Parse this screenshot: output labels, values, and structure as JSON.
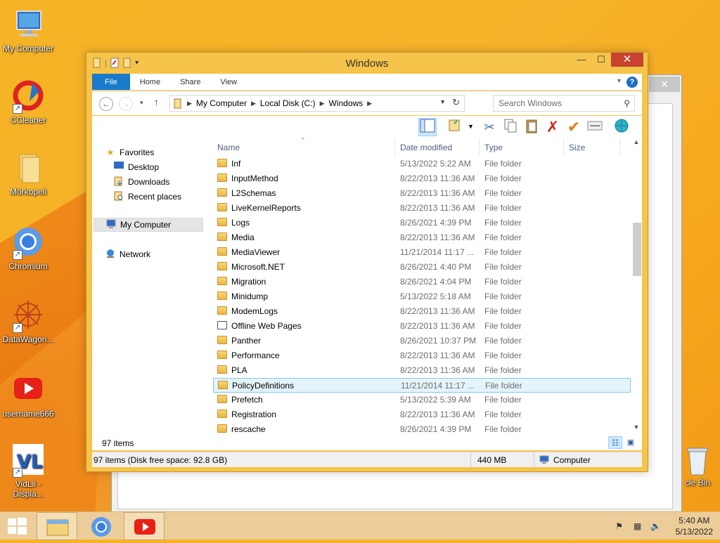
{
  "desktop": {
    "icons": [
      {
        "label": "My Computer"
      },
      {
        "label": "CCleaner"
      },
      {
        "label": "Mörkopeli"
      },
      {
        "label": "Chromium"
      },
      {
        "label": "DataWagon..."
      },
      {
        "label": "username666"
      },
      {
        "label": "VidLii -\nDispla..."
      }
    ],
    "recycle_bin_label": "cle Bin"
  },
  "window": {
    "title": "Windows",
    "ribbon_tabs": [
      "File",
      "Home",
      "Share",
      "View"
    ],
    "help": "?",
    "address": {
      "crumbs": [
        "My Computer",
        "Local Disk (C:)",
        "Windows"
      ]
    },
    "search": {
      "placeholder": "Search Windows"
    },
    "nav": {
      "favorites": "Favorites",
      "desktop": "Desktop",
      "downloads": "Downloads",
      "recent": "Recent places",
      "computer": "My Computer",
      "network": "Network"
    },
    "columns": {
      "name": "Name",
      "date": "Date modified",
      "type": "Type",
      "size": "Size"
    },
    "files": [
      {
        "name": "Inf",
        "date": "5/13/2022 5:22 AM",
        "type": "File folder"
      },
      {
        "name": "InputMethod",
        "date": "8/22/2013 11:36 AM",
        "type": "File folder"
      },
      {
        "name": "L2Schemas",
        "date": "8/22/2013 11:36 AM",
        "type": "File folder"
      },
      {
        "name": "LiveKernelReports",
        "date": "8/22/2013 11:36 AM",
        "type": "File folder"
      },
      {
        "name": "Logs",
        "date": "8/26/2021 4:39 PM",
        "type": "File folder"
      },
      {
        "name": "Media",
        "date": "8/22/2013 11:36 AM",
        "type": "File folder"
      },
      {
        "name": "MediaViewer",
        "date": "11/21/2014 11:17 ...",
        "type": "File folder"
      },
      {
        "name": "Microsoft.NET",
        "date": "8/26/2021 4:40 PM",
        "type": "File folder"
      },
      {
        "name": "Migration",
        "date": "8/26/2021 4:04 PM",
        "type": "File folder"
      },
      {
        "name": "Minidump",
        "date": "5/13/2022 5:18 AM",
        "type": "File folder"
      },
      {
        "name": "ModemLogs",
        "date": "8/22/2013 11:36 AM",
        "type": "File folder"
      },
      {
        "name": "Offline Web Pages",
        "date": "8/22/2013 11:36 AM",
        "type": "File folder"
      },
      {
        "name": "Panther",
        "date": "8/26/2021 10:37 PM",
        "type": "File folder"
      },
      {
        "name": "Performance",
        "date": "8/22/2013 11:36 AM",
        "type": "File folder"
      },
      {
        "name": "PLA",
        "date": "8/22/2013 11:36 AM",
        "type": "File folder"
      },
      {
        "name": "PolicyDefinitions",
        "date": "11/21/2014 11:17 ...",
        "type": "File folder"
      },
      {
        "name": "Prefetch",
        "date": "5/13/2022 5:39 AM",
        "type": "File folder"
      },
      {
        "name": "Registration",
        "date": "8/22/2013 11:36 AM",
        "type": "File folder"
      },
      {
        "name": "rescache",
        "date": "8/26/2021 4:39 PM",
        "type": "File folder"
      }
    ],
    "selected_file": "PolicyDefinitions",
    "status": {
      "item_count": "97 items"
    },
    "details": {
      "summary": "97 items (Disk free space: 92.8 GB)",
      "size": "440 MB",
      "location": "Computer"
    }
  },
  "taskbar": {
    "time": "5:40 AM",
    "date": "5/13/2022"
  },
  "colors": {
    "desktop": "#f5b325",
    "window_frame": "#f6c44a",
    "file_tab": "#1979ca",
    "close_button": "#c7432f",
    "selection": "#e5f3fb"
  }
}
